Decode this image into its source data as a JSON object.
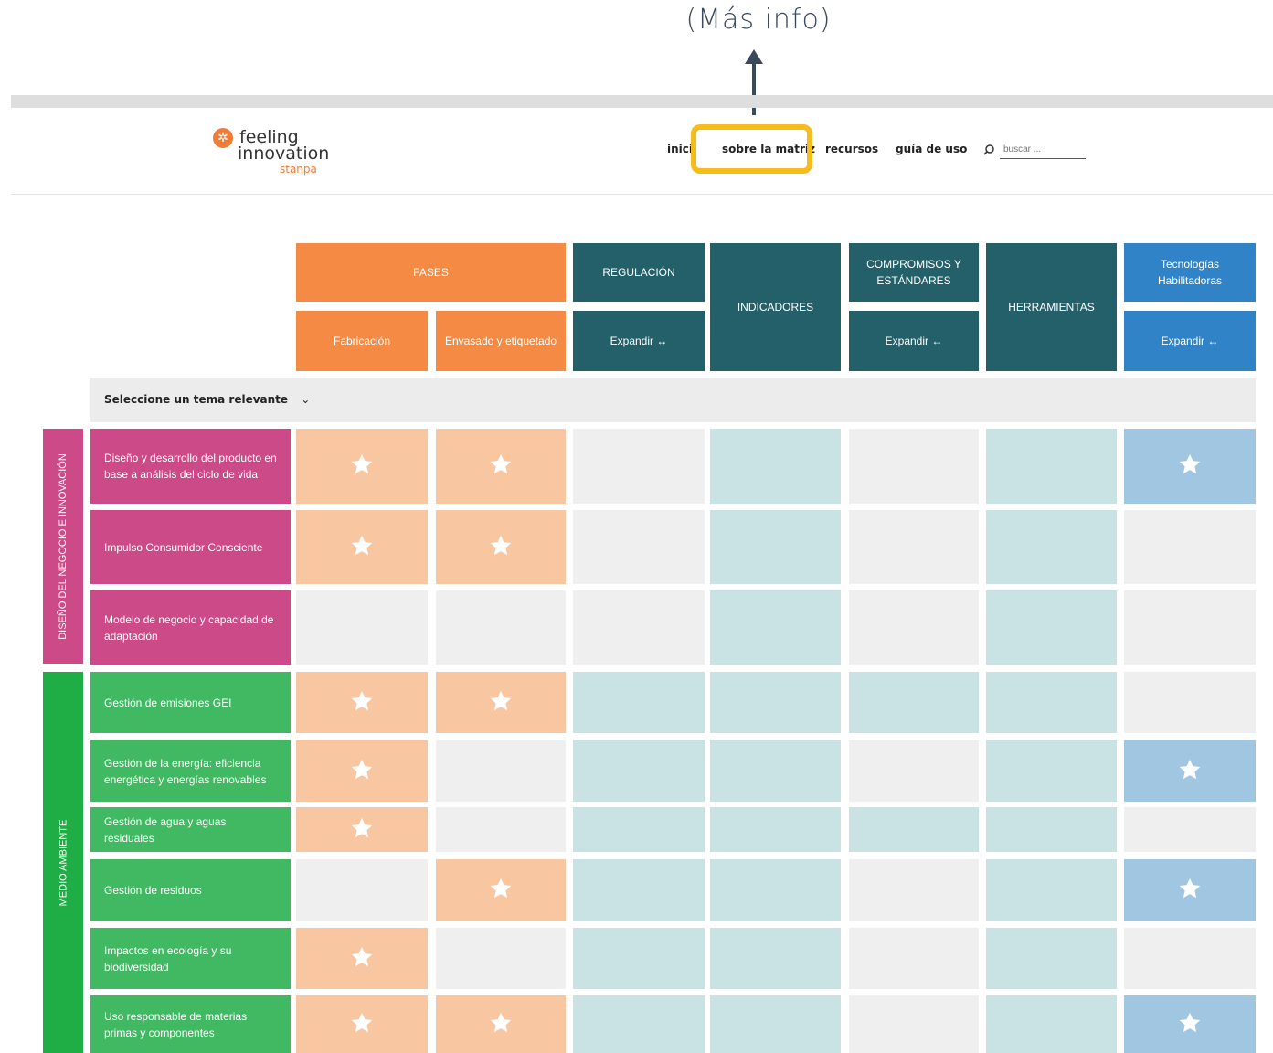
{
  "callout": {
    "label": "(Más info)"
  },
  "logo": {
    "line1": "feeling",
    "line2": "innovation",
    "line3": "stanpa"
  },
  "nav": {
    "items": [
      "inicio",
      "sobre la matriz",
      "recursos",
      "guía de uso"
    ],
    "search_placeholder": "buscar ..."
  },
  "headers": {
    "fases": "FASES",
    "fabricacion": "Fabricación",
    "envasado": "Envasado y etiquetado",
    "regulacion": "REGULACIÓN",
    "regulacion_expand": "Expandir ↔",
    "indicadores": "INDICADORES",
    "compromisos": "COMPROMISOS Y ESTÁNDARES",
    "compromisos_expand": "Expandir ↔",
    "herramientas": "HERRAMIENTAS",
    "tecnologias": "Tecnologías Habilitadoras",
    "tecnologias_expand": "Expandir ↔"
  },
  "selector": {
    "label": "Seleccione un tema relevante",
    "chevron": "chevron-down-icon"
  },
  "categories": [
    {
      "label": "DISEÑO DEL NEGOCIO E INNOVACIÓN",
      "color": "#cc4a87"
    },
    {
      "label": "MEDIO AMBIENTE",
      "color": "#1fae45"
    }
  ],
  "rows": [
    {
      "label": "Diseño y desarrollo del producto en base a análisis del ciclo de vida",
      "category": 0,
      "cells": [
        "star",
        "star",
        "empty",
        "empty",
        "empty",
        "empty",
        "star"
      ]
    },
    {
      "label": "Impulso Consumidor Consciente",
      "category": 0,
      "cells": [
        "star",
        "star",
        "empty",
        "empty",
        "empty",
        "empty",
        "empty"
      ]
    },
    {
      "label": "Modelo de negocio y capacidad de adaptación",
      "category": 0,
      "cells": [
        "empty",
        "empty",
        "empty",
        "empty",
        "empty",
        "empty",
        "empty"
      ]
    },
    {
      "label": "Gestión de emisiones GEI",
      "category": 1,
      "cells": [
        "star",
        "star",
        "empty",
        "empty",
        "empty",
        "empty",
        "empty"
      ]
    },
    {
      "label": "Gestión de la energía: eficiencia energética y energías renovables",
      "category": 1,
      "cells": [
        "star",
        "empty",
        "empty",
        "empty",
        "empty",
        "empty",
        "star"
      ]
    },
    {
      "label": "Gestión de agua y aguas residuales",
      "category": 1,
      "cells": [
        "star",
        "empty",
        "empty",
        "empty",
        "empty",
        "empty",
        "empty"
      ]
    },
    {
      "label": "Gestión de residuos",
      "category": 1,
      "cells": [
        "empty",
        "star",
        "empty",
        "empty",
        "empty",
        "empty",
        "star"
      ]
    },
    {
      "label": "Impactos en ecología y su biodiversidad",
      "category": 1,
      "cells": [
        "star",
        "empty",
        "empty",
        "empty",
        "empty",
        "empty",
        "empty"
      ]
    },
    {
      "label": "Uso responsable de materias primas y componentes",
      "category": 1,
      "cells": [
        "star",
        "star",
        "empty",
        "empty",
        "empty",
        "empty",
        "star"
      ]
    }
  ],
  "colors": {
    "orange": "#f58a45",
    "teal": "#23606a",
    "blue": "#3183c8",
    "peach": "#f9c6a2",
    "gray": "#efefef",
    "light_teal": "#c9e3e5",
    "light_blue": "#a0c6e2",
    "highlight": "#f6bc1c"
  }
}
